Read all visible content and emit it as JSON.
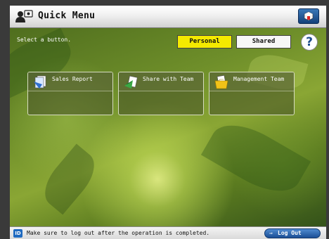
{
  "header": {
    "title": "Quick Menu",
    "icon": "users-icon",
    "settings_icon": "settings-box-icon"
  },
  "main": {
    "instruction": "Select a button.",
    "tabs": [
      {
        "label": "Personal",
        "selected": true,
        "color": "#f5ea00"
      },
      {
        "label": "Shared",
        "selected": false
      }
    ],
    "help_label": "?",
    "buttons": [
      {
        "label": "Sales Report",
        "icon": "document-stack-icon"
      },
      {
        "label": "Share with Team",
        "icon": "send-document-icon"
      },
      {
        "label": "Management Team",
        "icon": "folder-documents-icon"
      }
    ]
  },
  "footer": {
    "id_badge": "ID",
    "message": "Make sure to log out after the operation is completed.",
    "logout_label": "Log Out",
    "logout_arrow": "⇒"
  },
  "colors": {
    "accent_blue": "#1f4c8c",
    "selected_tab": "#f5ea00"
  }
}
